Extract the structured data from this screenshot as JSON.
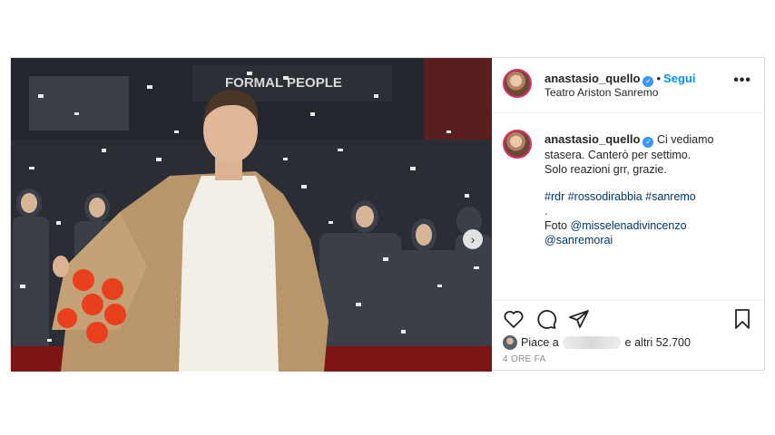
{
  "post": {
    "username": "anastasio_quello",
    "follow_label": "Segui",
    "location": "Teatro Ariston Sanremo",
    "more_icon": "ellipsis-icon"
  },
  "photo": {
    "sign_text": "FORMAL PEOPLE",
    "next_icon": "chevron-right-icon"
  },
  "caption": {
    "username": "anastasio_quello",
    "text_line1": "Ci vediamo",
    "text_line2": "stasera. Canterò per settimo.",
    "text_line3": "Solo reazioni grr, grazie.",
    "hashtags": "#rdr #rossodirabbia #sanremo",
    "period": ".",
    "credit_prefix": "Foto",
    "credit_mention1": "@misselenadivincenzo",
    "credit_mention2": "@sanremorai",
    "time": "4 h"
  },
  "actions": {
    "like_icon": "heart-icon",
    "comment_icon": "comment-icon",
    "share_icon": "share-icon",
    "save_icon": "bookmark-icon"
  },
  "likes": {
    "prefix": "Piace a",
    "suffix": "e altri 52.700"
  },
  "timestamp": "4 ORE FA",
  "colors": {
    "accent_blue": "#0095f6",
    "link": "#00376b",
    "text": "#262626",
    "muted": "#8e8e8e",
    "coat": "#b8956a",
    "shirt": "#f2efe8"
  }
}
